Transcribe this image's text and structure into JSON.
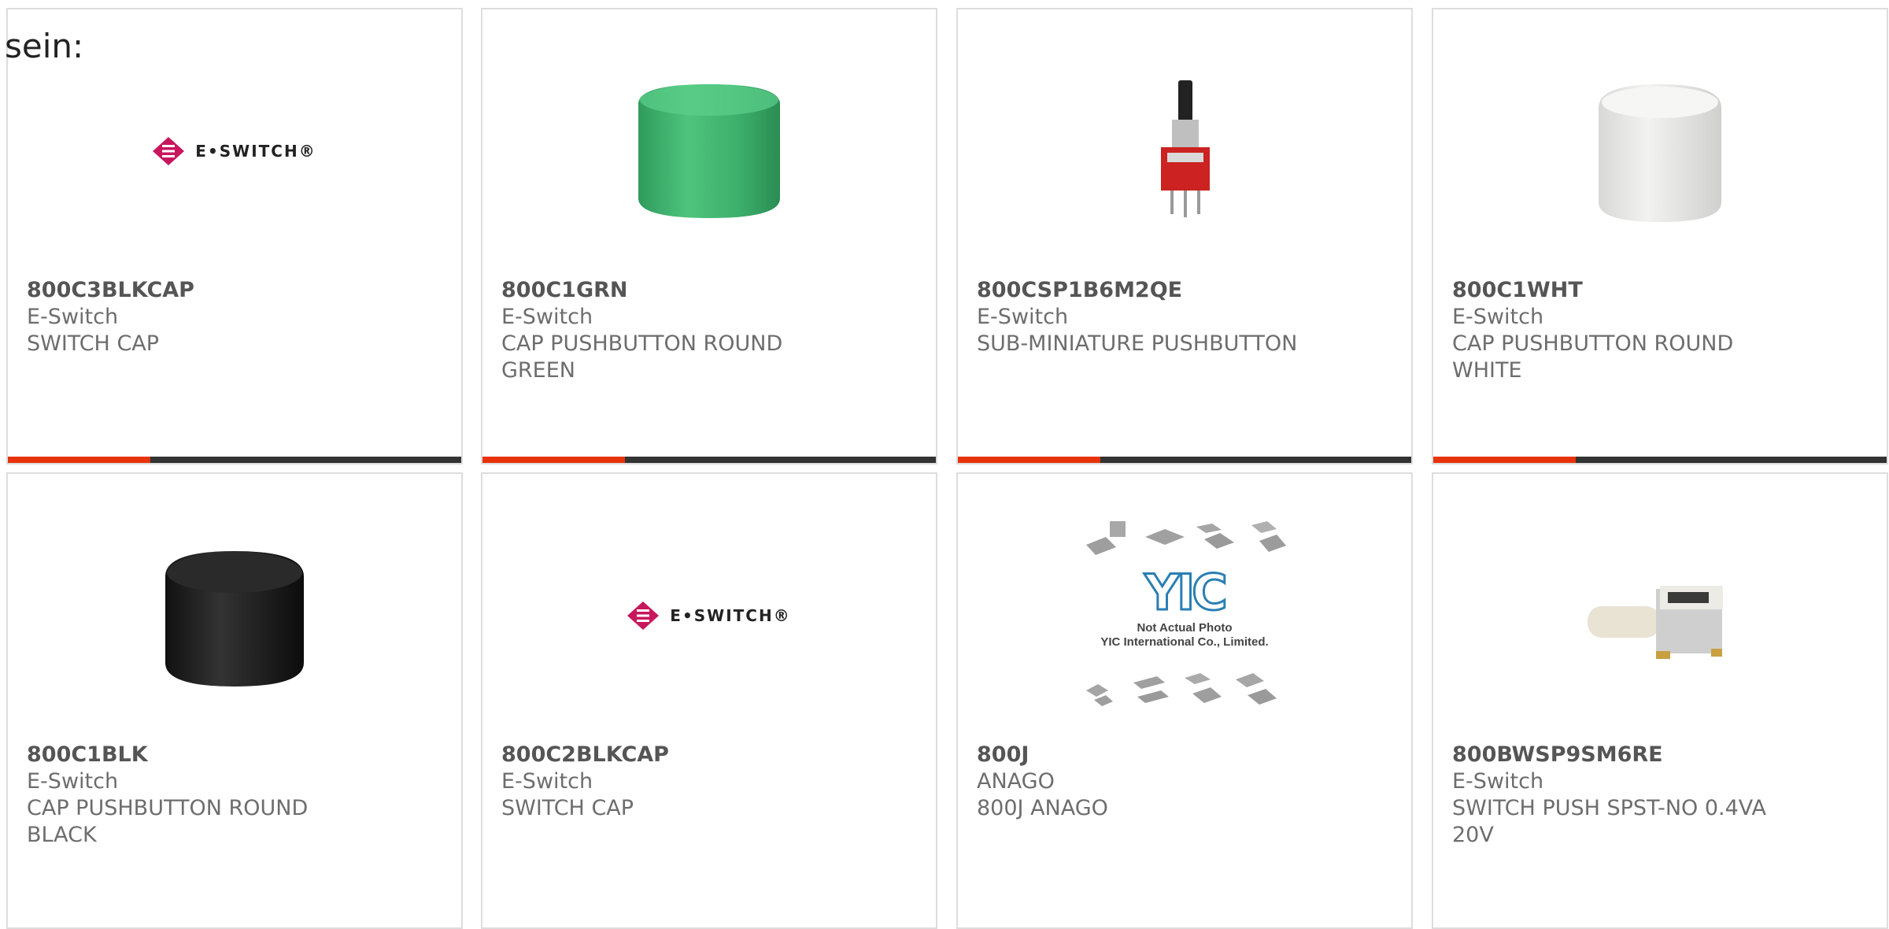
{
  "page": {
    "partial_label": "sein:"
  },
  "colors": {
    "accent": "#e8330a",
    "bar_dark": "#333333",
    "border": "#dddddd",
    "text": "#6d6d6d",
    "eswitch_magenta": "#c8175d",
    "yic_blue": "#2a7fb4"
  },
  "products": [
    {
      "part_number": "800C3BLKCAP",
      "manufacturer": "E-Switch",
      "description": "SWITCH CAP",
      "image": "eswitch-logo",
      "logo_text": "E•SWITCH®"
    },
    {
      "part_number": "800C1GRN",
      "manufacturer": "E-Switch",
      "description": "CAP PUSHBUTTON ROUND GREEN",
      "image": "green-round-cap"
    },
    {
      "part_number": "800CSP1B6M2QE",
      "manufacturer": "E-Switch",
      "description": "SUB-MINIATURE PUSHBUTTON",
      "image": "red-pushbutton-switch"
    },
    {
      "part_number": "800C1WHT",
      "manufacturer": "E-Switch",
      "description": "CAP PUSHBUTTON ROUND WHITE",
      "image": "white-round-cap"
    },
    {
      "part_number": "800C1BLK",
      "manufacturer": "E-Switch",
      "description": "CAP PUSHBUTTON ROUND BLACK",
      "image": "black-round-cap"
    },
    {
      "part_number": "800C2BLKCAP",
      "manufacturer": "E-Switch",
      "description": "SWITCH CAP",
      "image": "eswitch-logo",
      "logo_text": "E•SWITCH®"
    },
    {
      "part_number": "800J",
      "manufacturer": "ANAGO",
      "description": "800J ANAGO",
      "image": "yic-placeholder",
      "placeholder_logo": "YIC",
      "placeholder_caption_1": "Not Actual Photo",
      "placeholder_caption_2": "YIC International Co., Limited."
    },
    {
      "part_number": "800BWSP9SM6RE",
      "manufacturer": "E-Switch",
      "description": "SWITCH PUSH SPST-NO 0.4VA 20V",
      "image": "pushbutton-switch-body"
    }
  ]
}
